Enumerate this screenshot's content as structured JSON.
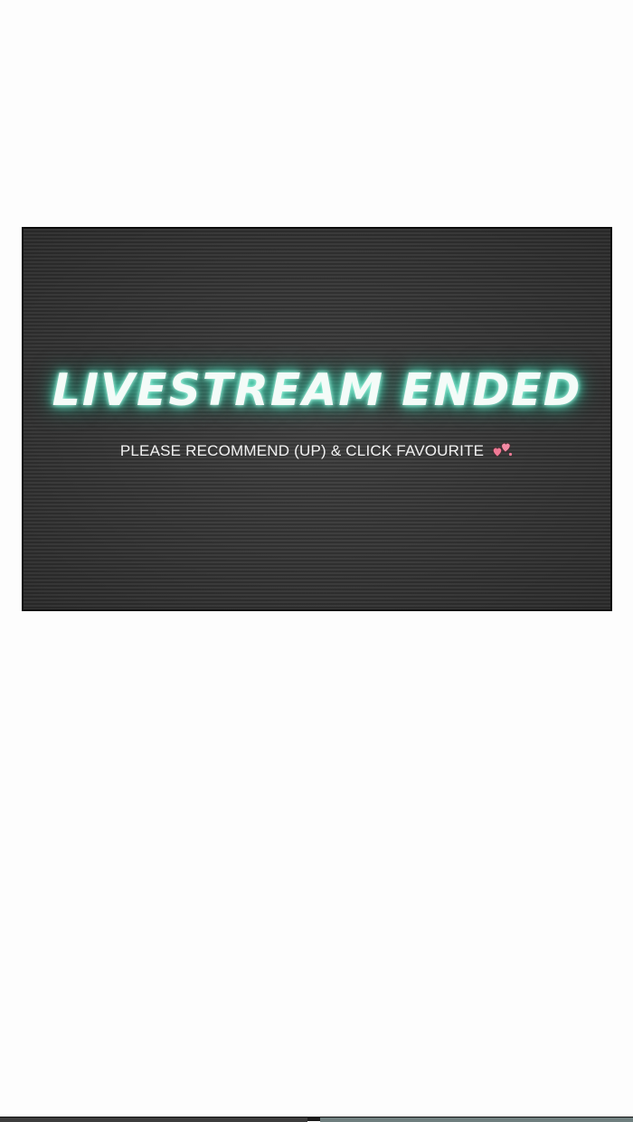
{
  "panel": {
    "headline": "LIVESTREAM ENDED",
    "subline": "PLEASE RECOMMEND (UP) & CLICK FAVOURITE",
    "icon": "hearts-icon",
    "colors": {
      "background": "#3b3b3b",
      "glow": "#59e3c2",
      "heart": "#f07a96"
    }
  }
}
